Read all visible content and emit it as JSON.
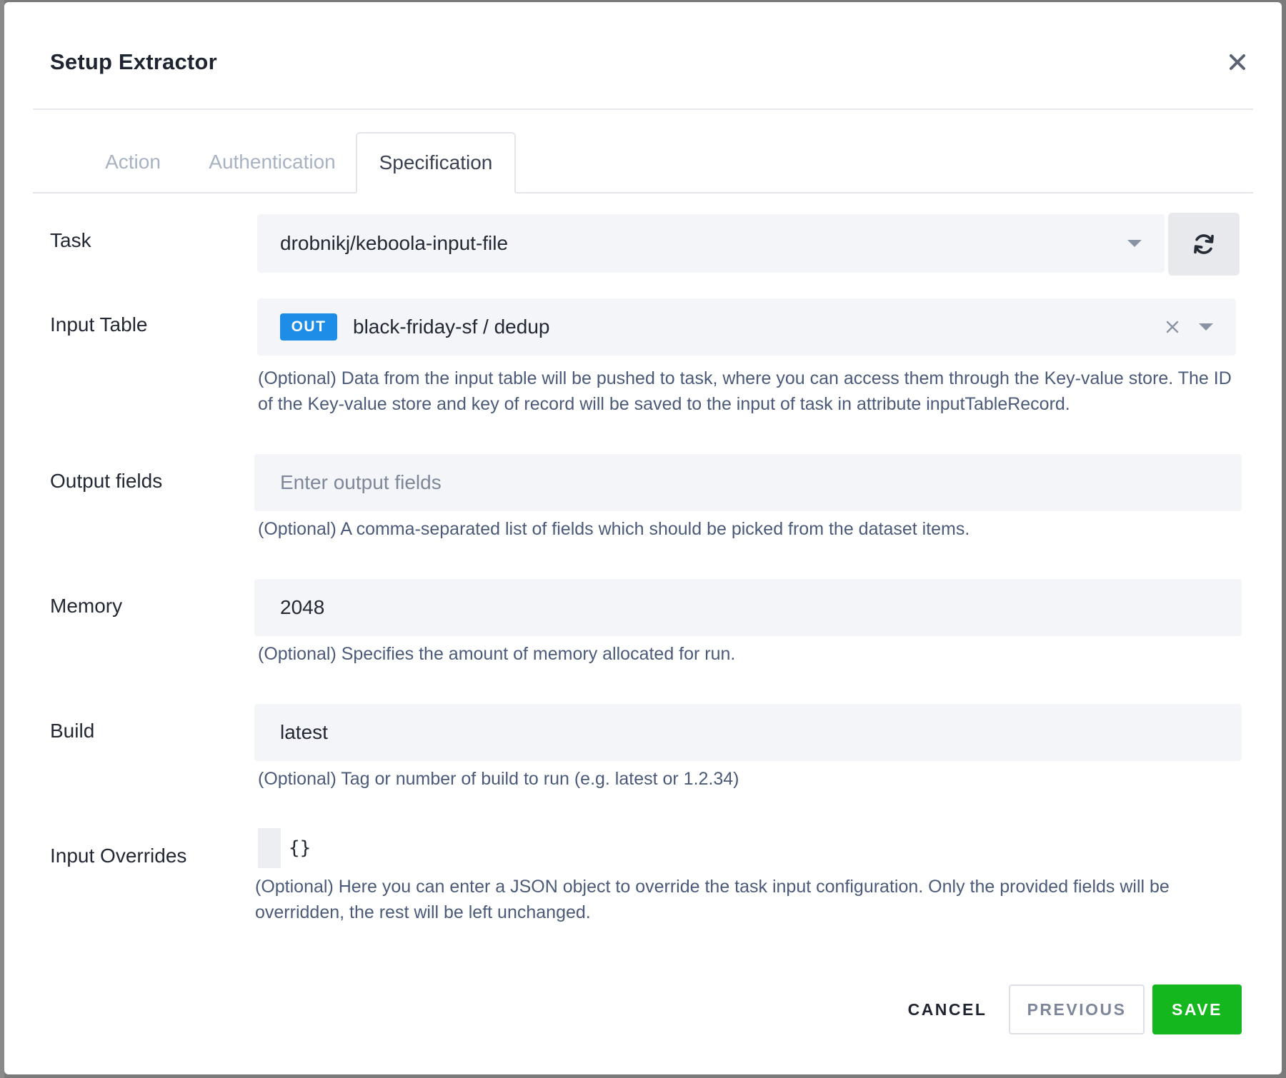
{
  "dialog": {
    "title": "Setup Extractor"
  },
  "tabs": [
    {
      "label": "Action",
      "active": false
    },
    {
      "label": "Authentication",
      "active": false
    },
    {
      "label": "Specification",
      "active": true
    }
  ],
  "form": {
    "task": {
      "label": "Task",
      "value": "drobnikj/keboola-input-file"
    },
    "input_table": {
      "label": "Input Table",
      "badge": "OUT",
      "value": "black-friday-sf / dedup",
      "help": "(Optional) Data from the input table will be pushed to task, where you can access them through the Key-value store. The ID of the Key-value store and key of record will be saved to the input of task in attribute inputTableRecord."
    },
    "output_fields": {
      "label": "Output fields",
      "value": "",
      "placeholder": "Enter output fields",
      "help": "(Optional) A comma-separated list of fields which should be picked from the dataset items."
    },
    "memory": {
      "label": "Memory",
      "value": "2048",
      "help": "(Optional) Specifies the amount of memory allocated for run."
    },
    "build": {
      "label": "Build",
      "value": "latest",
      "help": "(Optional) Tag or number of build to run (e.g. latest or 1.2.34)"
    },
    "input_overrides": {
      "label": "Input Overrides",
      "value": "{}",
      "help": "(Optional) Here you can enter a JSON object to override the task input configuration. Only the provided fields will be overridden, the rest will be left unchanged."
    }
  },
  "footer": {
    "cancel_label": "CANCEL",
    "previous_label": "PREVIOUS",
    "save_label": "SAVE"
  },
  "colors": {
    "badge": "#1d8de8",
    "save": "#14b81e",
    "field_bg": "#f4f5f8"
  }
}
